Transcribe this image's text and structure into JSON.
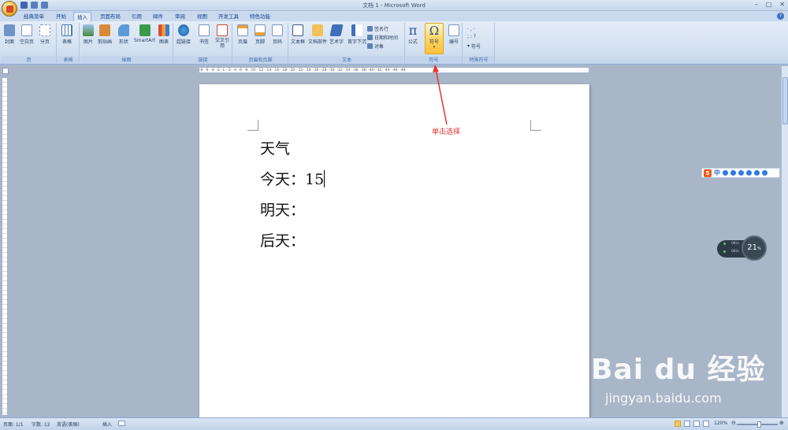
{
  "window": {
    "title": "文档 1 - Microsoft Word"
  },
  "tabs": [
    "经典菜单",
    "开始",
    "插入",
    "页面布局",
    "引用",
    "邮件",
    "审阅",
    "视图",
    "开发工具",
    "特色功能"
  ],
  "active_tab": "插入",
  "ribbon": {
    "groups": {
      "pages": "页",
      "tables": "表格",
      "illustrations": "插图",
      "links": "链接",
      "header_footer": "页眉和页脚",
      "text": "文本",
      "symbols": "符号",
      "special_symbols": "特殊符号"
    },
    "buttons": {
      "cover": "封面",
      "blank_page": "空白页",
      "page_break": "分页",
      "table": "表格",
      "picture": "图片",
      "clip_art": "剪贴画",
      "shapes": "形状",
      "smartart": "SmartArt",
      "chart": "图表",
      "hyperlink": "超链接",
      "bookmark": "书签",
      "cross_ref": "交叉引用",
      "header": "页眉",
      "footer": "页脚",
      "page_number": "页码",
      "text_box": "文本框",
      "quick_parts": "文档部件",
      "wordart": "艺术字",
      "drop_cap": "首字下沉",
      "signature_line": "签名行",
      "date_time": "日期和时间",
      "object": "对象",
      "equation": "公式",
      "symbol": "符号",
      "numbering": "编号",
      "special_symbol": "符号"
    }
  },
  "ruler_text": "·8· ·6· ·4· ·2· ·L· ·2· ·4· ·6· ·8· ·10· ·12· ·14· ·16· ·18· ·20· ·22· ·24· ·26· ·28· ·30· ·32· ·34· ·36· ·38· ·40· ·42· ·44· ·46· ·48·",
  "document": {
    "lines": [
      "天气",
      "今天：15",
      "明天：",
      "后天："
    ]
  },
  "annotation": "单击选择",
  "ime": {
    "logo": "S",
    "mode": "中"
  },
  "net_widget": {
    "up": "0K/s",
    "down": "0K/s",
    "percent": "21",
    "percent_unit": "%"
  },
  "statusbar": {
    "page": "页面: 1/1",
    "words": "字数: 12",
    "language": "英语(美国)",
    "insert_mode": "插入",
    "zoom": "120%"
  },
  "watermark": {
    "main": "Bai du 经验",
    "sub": "jingyan.baidu.com"
  },
  "colors": {
    "accent": "#ffd35a",
    "annotation": "#e2352d",
    "ribbon": "#dfe8f5"
  }
}
